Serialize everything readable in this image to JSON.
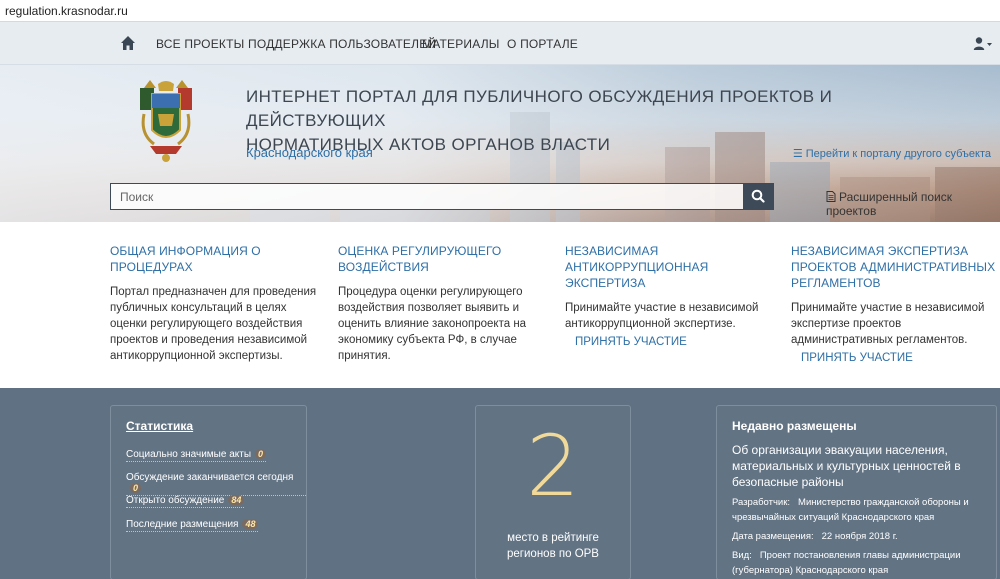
{
  "browser": {
    "url": "regulation.krasnodar.ru"
  },
  "nav": {
    "home_icon": "home-icon",
    "items": [
      "ВСЕ ПРОЕКТЫ",
      "ПОДДЕРЖКА ПОЛЬЗОВАТЕЛЕЙ",
      "МАТЕРИАЛЫ",
      "О ПОРТАЛЕ"
    ],
    "user_icon": "user-icon"
  },
  "hero": {
    "title_line1": "ИНТЕРНЕТ ПОРТАЛ ДЛЯ ПУБЛИЧНОГО ОБСУЖДЕНИЯ ПРОЕКТОВ И ДЕЙСТВУЮЩИХ",
    "title_line2": "НОРМАТИВНЫХ АКТОВ ОРГАНОВ ВЛАСТИ",
    "region": "Краснодарского края",
    "other_portal": "Перейти к порталу другого субъекта",
    "search_placeholder": "Поиск",
    "advanced_search": "Расширенный поиск проектов"
  },
  "columns": [
    {
      "title": "ОБЩАЯ ИНФОРМАЦИЯ О ПРОЦЕДУРАХ",
      "text": "Портал предназначен для проведения публичных консультаций в целях оценки регулирующего воздействия проектов и проведения независимой антикоррупционной экспертизы."
    },
    {
      "title": "ОЦЕНКА РЕГУЛИРУЮЩЕГО ВОЗДЕЙСТВИЯ",
      "text": "Процедура оценки регулирующего воздействия позволяет выявить и оценить влияние законопроекта на экономику субъекта РФ, в случае принятия."
    },
    {
      "title": "НЕЗАВИСИМАЯ АНТИКОРРУПЦИОННАЯ ЭКСПЕРТИЗА",
      "text": "Принимайте участие в независимой антикоррупционной экспертизе.",
      "action": "ПРИНЯТЬ УЧАСТИЕ"
    },
    {
      "title": "НЕЗАВИСИМАЯ ЭКСПЕРТИЗА ПРОЕКТОВ АДМИНИСТРАТИВНЫХ РЕГЛАМЕНТОВ",
      "text": "Принимайте участие в независимой экспертизе проектов административных регламентов.",
      "action": "ПРИНЯТЬ УЧАСТИЕ"
    }
  ],
  "stats": {
    "title": "Статистика",
    "rows": [
      {
        "label": "Социально значимые акты",
        "value": "0"
      },
      {
        "label": "Обсуждение заканчивается сегодня",
        "value": "0"
      },
      {
        "label": "Открыто обсуждение",
        "value": "84"
      },
      {
        "label": "Последние размещения",
        "value": "48"
      }
    ]
  },
  "rating": {
    "value": "2",
    "caption_line1": "место в рейтинге",
    "caption_line2": "регионов по ОРВ"
  },
  "recent": {
    "title": "Недавно размещены",
    "item_title": "Об организации эвакуации населения, материальных и культурных ценностей в безопасные районы",
    "developer_key": "Разработчик:",
    "developer_line1": "Министерство гражданской обороны и",
    "developer_line2": "чрезвычайных ситуаций Краснодарского края",
    "date_key": "Дата размещения:",
    "date_value": "22 ноября 2018 г.",
    "type_key": "Вид:",
    "type_line1": "Проект постановления главы администрации",
    "type_line2": "(губернатора) Краснодарского края"
  },
  "colors": {
    "accent": "#2e6fa6",
    "stats_bg": "#5f7182",
    "rating_number": "#f0d999",
    "search_button": "#3e4a57"
  }
}
